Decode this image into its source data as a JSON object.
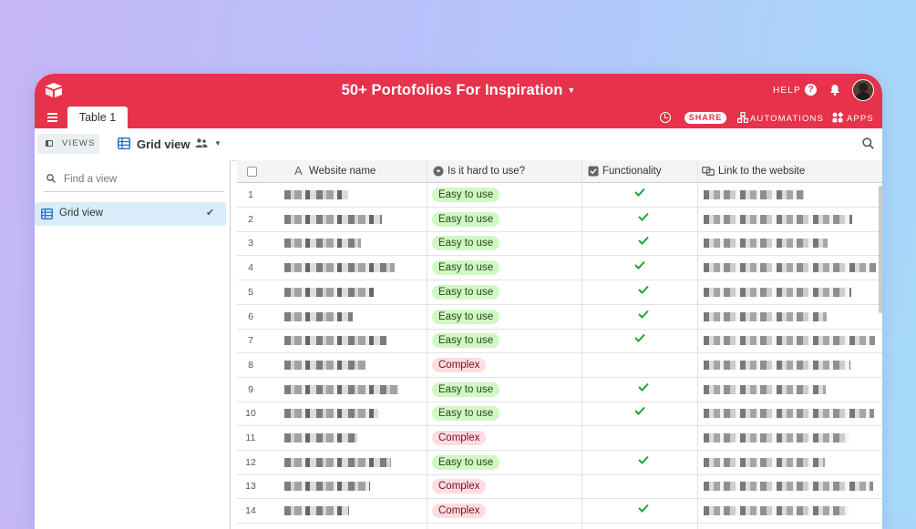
{
  "app": {
    "base_title": "50+ Portofolios For Inspiration",
    "help_label": "HELP",
    "share_label": "SHARE",
    "automations_label": "AUTOMATIONS",
    "apps_label": "APPS",
    "table_tab": "Table 1",
    "accent_color": "#e6324a"
  },
  "viewbar": {
    "views_label": "VIEWS",
    "current_view": "Grid view"
  },
  "sidebar": {
    "search_placeholder": "Find a view",
    "items": [
      {
        "label": "Grid view",
        "selected": true
      }
    ]
  },
  "grid": {
    "columns": [
      "Website name",
      "Is it hard to use?",
      "Functionality",
      "Link to the website"
    ],
    "rows": [
      {
        "num": "1",
        "difficulty": "Easy to use",
        "functional": true
      },
      {
        "num": "2",
        "difficulty": "Easy to use",
        "functional": true
      },
      {
        "num": "3",
        "difficulty": "Easy to use",
        "functional": true
      },
      {
        "num": "4",
        "difficulty": "Easy to use",
        "functional": true
      },
      {
        "num": "5",
        "difficulty": "Easy to use",
        "functional": true
      },
      {
        "num": "6",
        "difficulty": "Easy to use",
        "functional": true
      },
      {
        "num": "7",
        "difficulty": "Easy to use",
        "functional": true
      },
      {
        "num": "8",
        "difficulty": "Complex",
        "functional": false
      },
      {
        "num": "9",
        "difficulty": "Easy to use",
        "functional": true
      },
      {
        "num": "10",
        "difficulty": "Easy to use",
        "functional": true
      },
      {
        "num": "11",
        "difficulty": "Complex",
        "functional": false
      },
      {
        "num": "12",
        "difficulty": "Easy to use",
        "functional": true
      },
      {
        "num": "13",
        "difficulty": "Complex",
        "functional": false
      },
      {
        "num": "14",
        "difficulty": "Complex",
        "functional": true
      }
    ]
  },
  "icons": [
    "airtable-logo-icon",
    "menu-icon",
    "help-icon",
    "bell-icon",
    "history-icon",
    "automations-icon",
    "apps-icon",
    "grid-view-icon",
    "people-icon",
    "search-icon",
    "check-icon"
  ]
}
